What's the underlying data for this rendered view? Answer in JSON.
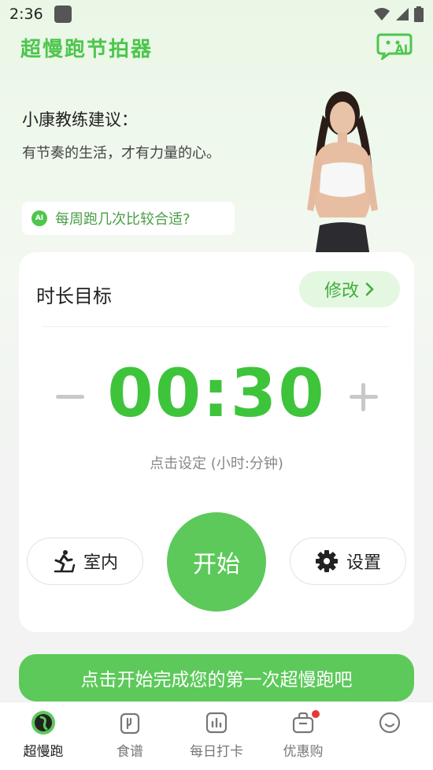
{
  "status_bar": {
    "time": "2:36"
  },
  "header": {
    "app_title": "超慢跑节拍器",
    "ai_label": "AI"
  },
  "coach": {
    "title": "小康教练建议：",
    "subtitle": "有节奏的生活，才有力量的心。"
  },
  "faq": {
    "ai_badge": "AI",
    "question": "每周跑几次比较合适?"
  },
  "goal_card": {
    "label": "时长目标",
    "modify_label": "修改",
    "time_value": "00:30",
    "hint": "点击设定 (小时:分钟)",
    "indoor_label": "室内",
    "start_label": "开始",
    "settings_label": "设置"
  },
  "cta": {
    "label": "点击开始完成您的第一次超慢跑吧"
  },
  "tabs": [
    {
      "label": "超慢跑",
      "icon": "run-icon"
    },
    {
      "label": "食谱",
      "icon": "recipe-icon"
    },
    {
      "label": "每日打卡",
      "icon": "chart-icon"
    },
    {
      "label": "优惠购",
      "icon": "bag-icon"
    },
    {
      "label": "",
      "icon": "smile-icon"
    }
  ],
  "colors": {
    "accent": "#5cc95a",
    "accent_text": "#3ec43a",
    "badge": "#e53935"
  }
}
